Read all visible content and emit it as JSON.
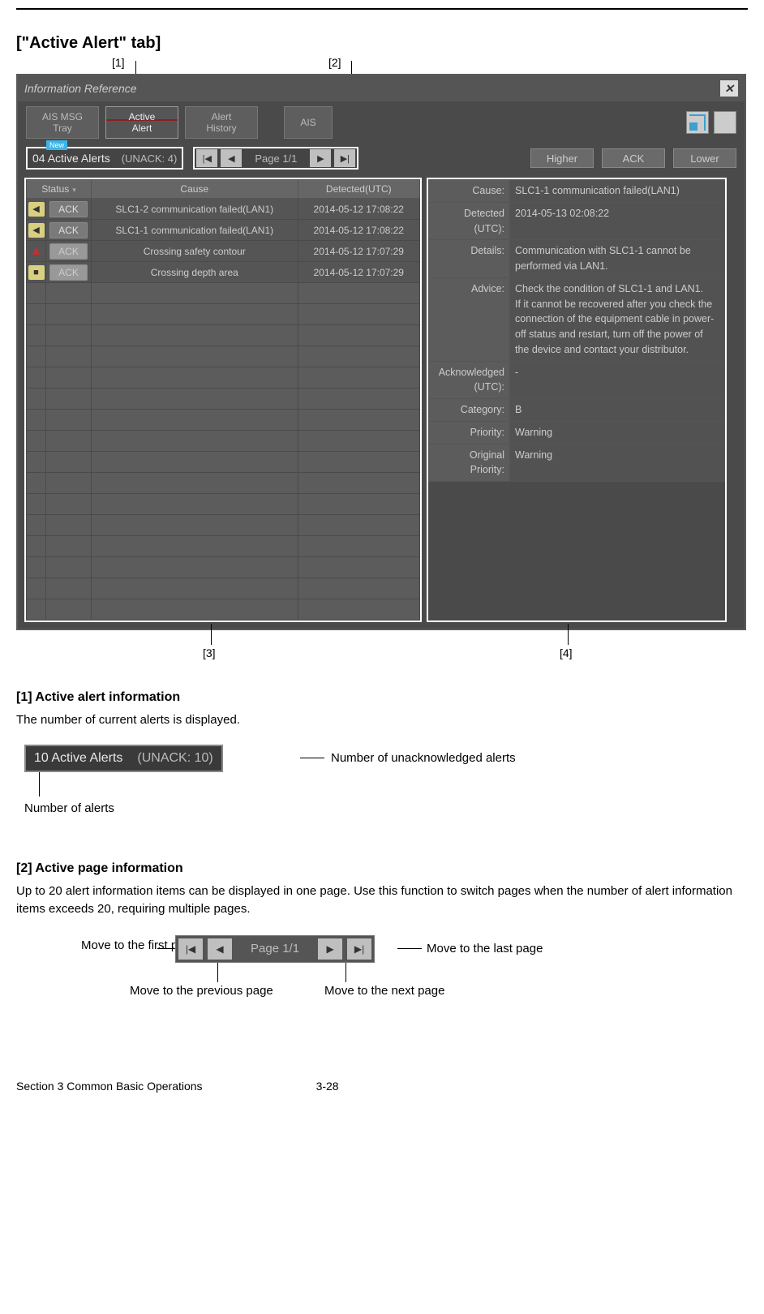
{
  "page": {
    "section_title": "[\"Active Alert\" tab]",
    "callouts": {
      "c1": "[1]",
      "c2": "[2]",
      "c3": "[3]",
      "c4": "[4]"
    }
  },
  "panel": {
    "title": "Information Reference",
    "tabs": {
      "t1": "AIS MSG\nTray",
      "t2": "Active\nAlert",
      "t3": "Alert\nHistory",
      "t4": "AIS"
    },
    "new_label": "New",
    "active_alerts": "04 Active Alerts",
    "unack": "(UNACK: 4)",
    "page_label": "Page 1/1",
    "btns": {
      "higher": "Higher",
      "ack": "ACK",
      "lower": "Lower"
    },
    "headers": {
      "status": "Status",
      "cause": "Cause",
      "detected": "Detected(UTC)"
    },
    "rows": [
      {
        "ack": "ACK",
        "icon": "yellow-arrow",
        "cause": "SLC1-2 communication failed(LAN1)",
        "detected": "2014-05-12 17:08:22"
      },
      {
        "ack": "ACK",
        "icon": "yellow-arrow",
        "cause": "SLC1-1 communication failed(LAN1)",
        "detected": "2014-05-12 17:08:22"
      },
      {
        "ack": "ACK",
        "icon": "red-tri",
        "cause": "Crossing safety contour",
        "detected": "2014-05-12 17:07:29"
      },
      {
        "ack": "ACK",
        "icon": "yellow-sq",
        "cause": "Crossing depth area",
        "detected": "2014-05-12 17:07:29"
      }
    ],
    "detail": {
      "cause_k": "Cause:",
      "cause_v": "SLC1-1 communication failed(LAN1)",
      "det_k": "Detected (UTC):",
      "det_v": "2014-05-13 02:08:22",
      "dtl_k": "Details:",
      "dtl_v": "Communication with SLC1-1 cannot be performed via LAN1.",
      "adv_k": "Advice:",
      "adv_v": "Check the condition of SLC1-1 and LAN1.\nIf it cannot be recovered after you check the connection of the equipment cable in power-off status and restart, turn off the power of the device and contact your distributor.",
      "ack_k": "Acknowledged (UTC):",
      "ack_v": "-",
      "cat_k": "Category:",
      "cat_v": "B",
      "pri_k": "Priority:",
      "pri_v": "Warning",
      "opri_k": "Original Priority:",
      "opri_v": "Warning"
    }
  },
  "exp1": {
    "head": "[1]  Active alert information",
    "body": "The number of current alerts is displayed.",
    "mini_count": "10 Active Alerts",
    "mini_unack": "(UNACK: 10)",
    "note_right": "Number of unacknowledged alerts",
    "note_bottom": "Number of alerts"
  },
  "exp2": {
    "head": "[2]  Active page information",
    "body": "Up to 20 alert information items can be displayed in one page. Use this function to switch pages when the number of alert information items exceeds 20, requiring multiple pages.",
    "page_label": "Page 1/1",
    "note_first": "Move to the first page",
    "note_prev": "Move to the previous page",
    "note_next": "Move to the next page",
    "note_last": "Move to the last page"
  },
  "footer": {
    "left": "Section 3    Common Basic Operations",
    "center": "3-28"
  }
}
